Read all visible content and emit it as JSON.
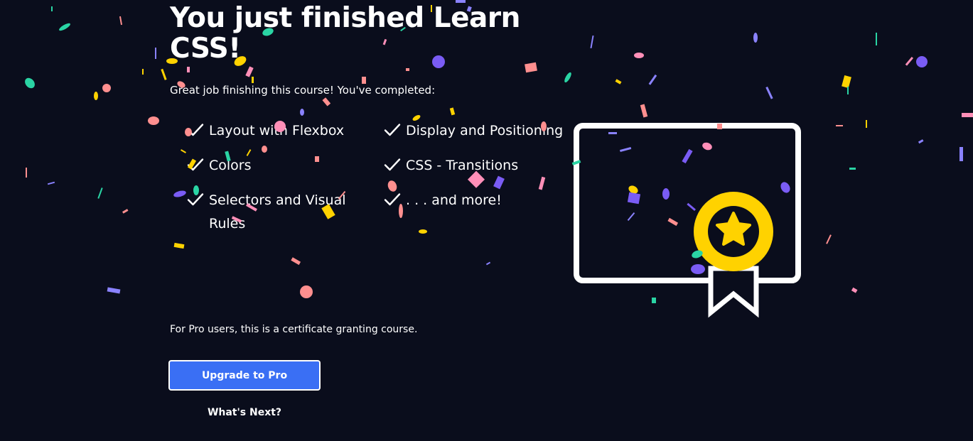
{
  "heading": {
    "title": "You just finished Learn CSS!",
    "subtitle": "Great job finishing this course! You've completed:"
  },
  "topics": [
    {
      "label": "Layout with Flexbox"
    },
    {
      "label": "Display and Positioning"
    },
    {
      "label": "Colors"
    },
    {
      "label": "CSS - Transitions"
    },
    {
      "label": "Selectors and Visual Rules"
    },
    {
      "label": ". . . and more!"
    }
  ],
  "footer": {
    "pro_note": "For Pro users, this is a certificate granting course.",
    "upgrade_label": "Upgrade to Pro",
    "next_label": "What's Next?"
  },
  "icons": {
    "check": "check-icon",
    "certificate": "certificate-icon",
    "medal": "star-medal-icon"
  },
  "colors": {
    "background": "#0a0d1c",
    "accent_button": "#3a6ff4",
    "medal": "#ffd200",
    "text": "#ffffff"
  }
}
